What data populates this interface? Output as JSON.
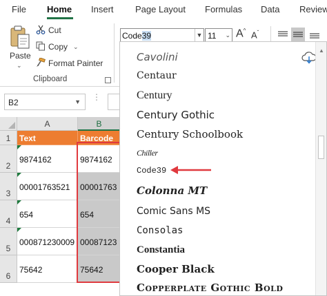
{
  "tabs": [
    "File",
    "Home",
    "Insert",
    "Page Layout",
    "Formulas",
    "Data",
    "Review"
  ],
  "active_tab": "Home",
  "clipboard": {
    "paste_label": "Paste",
    "cut_label": "Cut",
    "copy_label": "Copy",
    "format_painter_label": "Format Painter",
    "group_label": "Clipboard"
  },
  "font": {
    "name_pre": "Code",
    "name_sel": "39",
    "size": "11"
  },
  "name_box": "B2",
  "columns": [
    "A",
    "Barcode"
  ],
  "column_letters": [
    "A",
    "B"
  ],
  "rows": [
    "1",
    "2",
    "3",
    "4",
    "5",
    "6"
  ],
  "cells": {
    "header": [
      "Text",
      "Barcode"
    ],
    "a": [
      "9874162",
      "00001763521",
      "654",
      "000871230009",
      "75642"
    ],
    "b": [
      "9874162",
      "00001763",
      "654",
      "00087123",
      "75642"
    ]
  },
  "font_list": [
    "Cavolini",
    "Centaur",
    "Century",
    "Century Gothic",
    "Century Schoolbook",
    "Chiller",
    "Code39",
    "Colonna MT",
    "Comic Sans MS",
    "Consolas",
    "Constantia",
    "Cooper Black",
    "Copperplate Gothic Bold"
  ],
  "colors": {
    "accent_green": "#217346",
    "header_orange": "#ed7d31",
    "highlight_red": "#e0393e"
  }
}
